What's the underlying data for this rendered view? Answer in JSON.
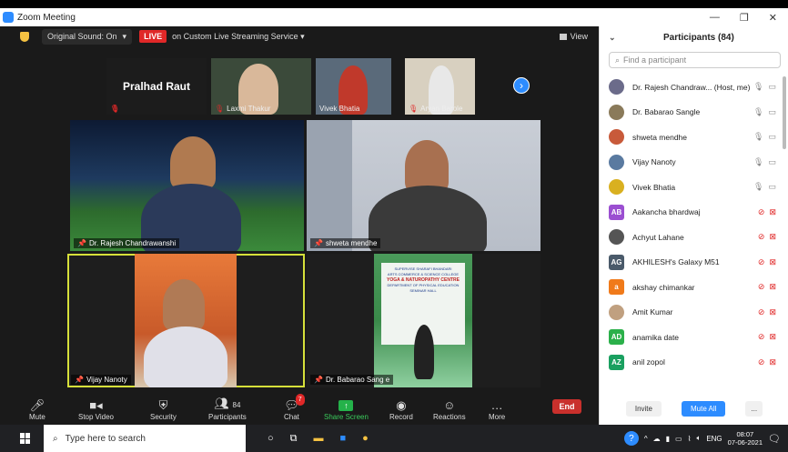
{
  "window": {
    "title": "Zoom Meeting",
    "controls": [
      "—",
      "❐",
      "✕"
    ]
  },
  "topbar": {
    "sound_label": "Original Sound: On",
    "live_label": "LIVE",
    "stream_label": "on Custom Live Streaming Service",
    "view_label": "View"
  },
  "strip": [
    {
      "name": "Pralhad Raut",
      "type": "name-only",
      "muted": true
    },
    {
      "name": "Laxmi Thakur",
      "muted": true
    },
    {
      "name": "Vivek Bhatia",
      "muted": false
    },
    {
      "name": "Aryan Barole",
      "muted": true
    }
  ],
  "tiles": [
    {
      "name": "Dr. Rajesh Chandrawanshi"
    },
    {
      "name": "shweta mendhe"
    },
    {
      "name": "Vijay Nanoty"
    },
    {
      "name": "Dr. Babarao Sang e"
    }
  ],
  "poster": {
    "lines": [
      "SUPERVISE SHARAFI BHANDARI",
      "ARTS COMMERCE & SCIENCE COLLEGE",
      "YOGA & NATUROPATHY CENTRE",
      "DEPARTMENT OF PHYSICAL EDUCATION",
      "SEMINAR HALL"
    ]
  },
  "toolbar": {
    "mute": "Mute",
    "stop_video": "Stop Video",
    "security": "Security",
    "participants": "Participants",
    "participants_count": "84",
    "chat": "Chat",
    "chat_badge": "7",
    "share_screen": "Share Screen",
    "record": "Record",
    "reactions": "Reactions",
    "more": "More",
    "end": "End"
  },
  "panel": {
    "title": "Participants (84)",
    "search_placeholder": "Find a participant",
    "invite": "Invite",
    "mute_all": "Mute All",
    "more": "..."
  },
  "participants": [
    {
      "name": "Dr. Rajesh Chandraw... (Host, me)",
      "avatar": "photo",
      "color": "#6b6b8a",
      "mic_on": true
    },
    {
      "name": "Dr. Babarao Sangle",
      "avatar": "photo",
      "color": "#8a7a5a",
      "mic_on": true
    },
    {
      "name": "shweta mendhe",
      "avatar": "photo",
      "color": "#c85a3a",
      "mic_on": true
    },
    {
      "name": "Vijay Nanoty",
      "avatar": "photo",
      "color": "#5a7aa0",
      "mic_on": true
    },
    {
      "name": "Vivek Bhatia",
      "avatar": "photo",
      "color": "#d9b020",
      "mic_on": true
    },
    {
      "name": "Aakancha bhardwaj",
      "avatar": "AB",
      "color": "#9b4fd1",
      "mic_on": false
    },
    {
      "name": "Achyut Lahane",
      "avatar": "photo",
      "color": "#555555",
      "mic_on": false
    },
    {
      "name": "AKHILESH's Galaxy M51",
      "avatar": "AG",
      "color": "#4a5a6a",
      "mic_on": false
    },
    {
      "name": "akshay chimankar",
      "avatar": "a",
      "color": "#f07a1a",
      "mic_on": false
    },
    {
      "name": "Amit Kumar",
      "avatar": "photo",
      "color": "#c0a080",
      "mic_on": false
    },
    {
      "name": "anamika date",
      "avatar": "AD",
      "color": "#2bb04a",
      "mic_on": false
    },
    {
      "name": "anil zopol",
      "avatar": "AZ",
      "color": "#1aa060",
      "mic_on": false
    }
  ],
  "taskbar": {
    "search_placeholder": "Type here to search",
    "lang": "ENG",
    "time": "08:07",
    "date": "07-06-2021"
  }
}
